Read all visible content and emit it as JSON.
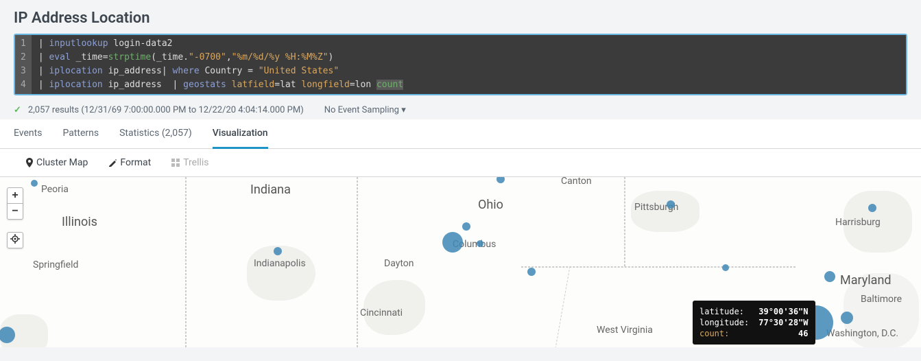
{
  "header": {
    "title": "IP Address Location"
  },
  "search": {
    "lines": [
      {
        "num": "1",
        "segments": [
          {
            "t": "| ",
            "c": "pipe"
          },
          {
            "t": "inputlookup",
            "c": "cmd2"
          },
          {
            "t": " login-data2",
            "c": "str"
          }
        ]
      },
      {
        "num": "2",
        "segments": [
          {
            "t": "| ",
            "c": "pipe"
          },
          {
            "t": "eval",
            "c": "cmd2"
          },
          {
            "t": " _time=",
            "c": "str"
          },
          {
            "t": "strptime",
            "c": "cmd"
          },
          {
            "t": "(_time.",
            "c": "str"
          },
          {
            "t": "\"-0700\"",
            "c": "q"
          },
          {
            "t": ",",
            "c": "str"
          },
          {
            "t": "\"%m/%d/%y %H:%M%Z\"",
            "c": "q"
          },
          {
            "t": ")",
            "c": "str"
          }
        ]
      },
      {
        "num": "3",
        "segments": [
          {
            "t": "| ",
            "c": "pipe"
          },
          {
            "t": "iplocation",
            "c": "cmd2"
          },
          {
            "t": " ip_address",
            "c": "str"
          },
          {
            "t": "| ",
            "c": "pipe"
          },
          {
            "t": "where",
            "c": "cmd2"
          },
          {
            "t": " Country = ",
            "c": "str"
          },
          {
            "t": "\"United States\"",
            "c": "q"
          }
        ]
      },
      {
        "num": "4",
        "segments": [
          {
            "t": "| ",
            "c": "pipe"
          },
          {
            "t": "iplocation",
            "c": "cmd2"
          },
          {
            "t": " ip_address  ",
            "c": "str"
          },
          {
            "t": "| ",
            "c": "pipe"
          },
          {
            "t": "geostats",
            "c": "cmd2"
          },
          {
            "t": " ",
            "c": "str"
          },
          {
            "t": "latfield",
            "c": "arg"
          },
          {
            "t": "=lat ",
            "c": "str"
          },
          {
            "t": "longfield",
            "c": "arg"
          },
          {
            "t": "=lon ",
            "c": "str"
          },
          {
            "t": "count",
            "c": "cmd sel"
          }
        ]
      }
    ]
  },
  "status": {
    "results": "2,057 results (12/31/69 7:00:00.000 PM to 12/22/20 4:04:14.000 PM)",
    "sampling": "No Event Sampling"
  },
  "tabs": {
    "events": "Events",
    "patterns": "Patterns",
    "stats": "Statistics (2,057)",
    "viz": "Visualization"
  },
  "toolbar": {
    "cluster": "Cluster Map",
    "format": "Format",
    "trellis": "Trellis"
  },
  "map": {
    "labels": {
      "peoria": "Peoria",
      "illinois": "Illinois",
      "springfield": "Springfield",
      "indiana": "Indiana",
      "indianapolis": "Indianapolis",
      "ohio": "Ohio",
      "columbus": "Columbus",
      "dayton": "Dayton",
      "cincinnati": "Cincinnati",
      "canton": "Canton",
      "pittsburgh": "Pittsburgh",
      "wv": "West Virginia",
      "harrisburg": "Harrisburg",
      "maryland": "Maryland",
      "baltimore": "Baltimore",
      "dc": "Washington, D.C."
    },
    "tooltip": {
      "lat_key": "latitude:",
      "lat_val": "39°00'36\"N",
      "lon_key": "longitude:",
      "lon_val": "77°30'28\"W",
      "cnt_key": "count:",
      "cnt_val": "46"
    }
  }
}
